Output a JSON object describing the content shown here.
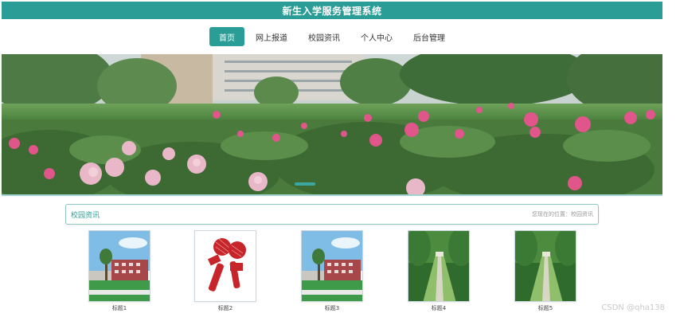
{
  "header": {
    "title": "新生入学服务管理系统"
  },
  "nav": {
    "items": [
      {
        "label": "首页",
        "active": true
      },
      {
        "label": "网上报道",
        "active": false
      },
      {
        "label": "校园资讯",
        "active": false
      },
      {
        "label": "个人中心",
        "active": false
      },
      {
        "label": "后台管理",
        "active": false
      }
    ]
  },
  "section": {
    "title": "校园资讯",
    "breadcrumb": "您现在的位置：校园资讯"
  },
  "thumbnails": [
    {
      "label": "标题1",
      "kind": "campus-building"
    },
    {
      "label": "标题2",
      "kind": "news-microphone"
    },
    {
      "label": "标题3",
      "kind": "campus-building"
    },
    {
      "label": "标题4",
      "kind": "tree-avenue"
    },
    {
      "label": "标题5",
      "kind": "tree-avenue"
    }
  ],
  "watermark": "CSDN @qha138",
  "colors": {
    "accent": "#2a9d96",
    "border": "#8fc7c3"
  }
}
